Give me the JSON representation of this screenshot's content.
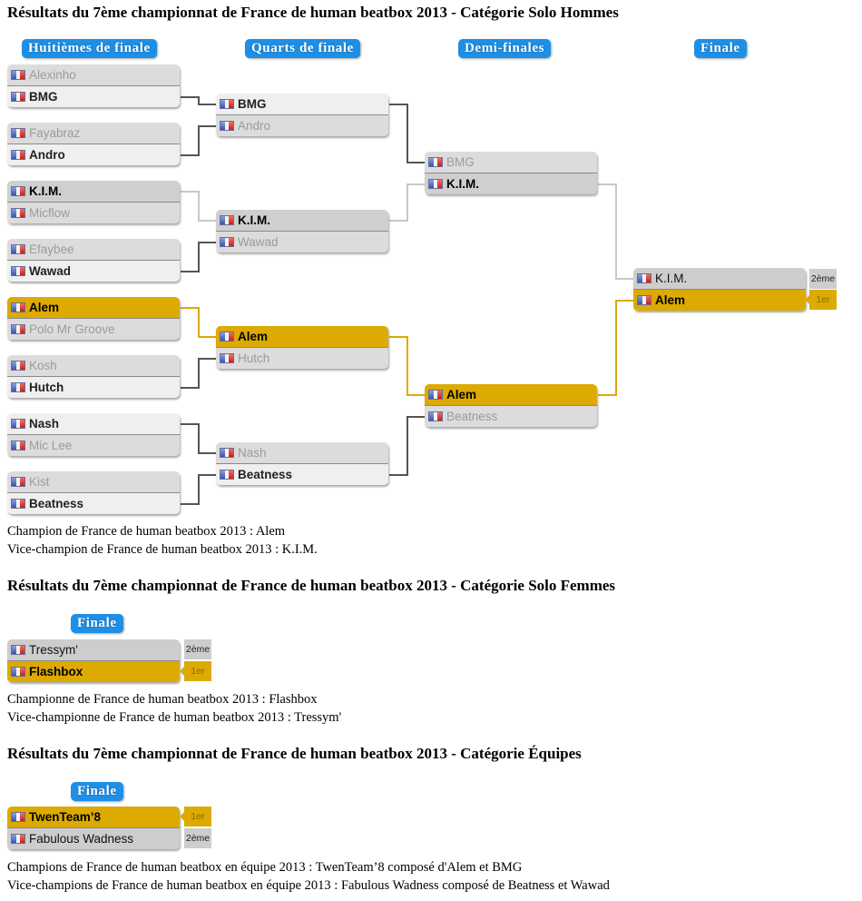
{
  "sections": [
    {
      "title": "Résultats du 7ème championnat de France de human beatbox 2013 - Catégorie Solo Hommes",
      "rounds": [
        "Huitièmes de finale",
        "Quarts de finale",
        "Demi-finales",
        "Finale"
      ],
      "round_of_16": [
        {
          "teams": [
            {
              "name": "Alexinho",
              "result": "lose"
            },
            {
              "name": "BMG",
              "result": "win"
            }
          ]
        },
        {
          "teams": [
            {
              "name": "Fayabraz",
              "result": "lose"
            },
            {
              "name": "Andro",
              "result": "win"
            }
          ]
        },
        {
          "teams": [
            {
              "name": "K.I.M.",
              "result": "win"
            },
            {
              "name": "Micflow",
              "result": "lose"
            }
          ]
        },
        {
          "teams": [
            {
              "name": "Efaybee",
              "result": "lose"
            },
            {
              "name": "Wawad",
              "result": "win"
            }
          ]
        },
        {
          "teams": [
            {
              "name": "Alem",
              "result": "win"
            },
            {
              "name": "Polo Mr Groove",
              "result": "lose"
            }
          ]
        },
        {
          "teams": [
            {
              "name": "Kosh",
              "result": "lose"
            },
            {
              "name": "Hutch",
              "result": "win"
            }
          ]
        },
        {
          "teams": [
            {
              "name": "Nash",
              "result": "win"
            },
            {
              "name": "Mic Lee",
              "result": "lose"
            }
          ]
        },
        {
          "teams": [
            {
              "name": "Kist",
              "result": "lose"
            },
            {
              "name": "Beatness",
              "result": "win"
            }
          ]
        }
      ],
      "quarterfinals": [
        {
          "teams": [
            {
              "name": "BMG",
              "result": "win"
            },
            {
              "name": "Andro",
              "result": "lose"
            }
          ]
        },
        {
          "teams": [
            {
              "name": "K.I.M.",
              "result": "win"
            },
            {
              "name": "Wawad",
              "result": "lose"
            }
          ]
        },
        {
          "teams": [
            {
              "name": "Alem",
              "result": "win"
            },
            {
              "name": "Hutch",
              "result": "lose"
            }
          ]
        },
        {
          "teams": [
            {
              "name": "Nash",
              "result": "lose"
            },
            {
              "name": "Beatness",
              "result": "win"
            }
          ]
        }
      ],
      "semifinals": [
        {
          "teams": [
            {
              "name": "BMG",
              "result": "lose"
            },
            {
              "name": "K.I.M.",
              "result": "win"
            }
          ]
        },
        {
          "teams": [
            {
              "name": "Alem",
              "result": "win"
            },
            {
              "name": "Beatness",
              "result": "lose"
            }
          ]
        }
      ],
      "final": {
        "teams": [
          {
            "name": "K.I.M.",
            "place": "2ème"
          },
          {
            "name": "Alem",
            "place": "1er"
          }
        ]
      },
      "results": [
        "Champion de France de human beatbox 2013 : Alem",
        "Vice-champion de France de human beatbox 2013 : K.I.M."
      ]
    },
    {
      "title": "Résultats du 7ème championnat de France de human beatbox 2013 - Catégorie Solo Femmes",
      "rounds": [
        "Finale"
      ],
      "final": {
        "teams": [
          {
            "name": "Tressym'",
            "place": "2ème"
          },
          {
            "name": "Flashbox",
            "place": "1er"
          }
        ]
      },
      "results": [
        "Championne de France de human beatbox 2013 : Flashbox",
        "Vice-championne de France de human beatbox 2013 : Tressym'"
      ]
    },
    {
      "title": "Résultats du 7ème championnat de France de human beatbox 2013 - Catégorie Équipes",
      "rounds": [
        "Finale"
      ],
      "final": {
        "teams": [
          {
            "name": "TwenTeam’8",
            "place": "1er"
          },
          {
            "name": "Fabulous Wadness",
            "place": "2ème"
          }
        ]
      },
      "results": [
        "Champions de France de human beatbox en équipe 2013 : TwenTeam’8 composé d'Alem et BMG",
        "Vice-champions de France de human beatbox en équipe 2013 : Fabulous Wadness composé de Beatness et Wawad"
      ]
    }
  ],
  "colors": {
    "round_label": "#1e8fe6",
    "champion": "#dcaa00",
    "line_dark": "#555555",
    "line_light": "#c8c8c8"
  }
}
